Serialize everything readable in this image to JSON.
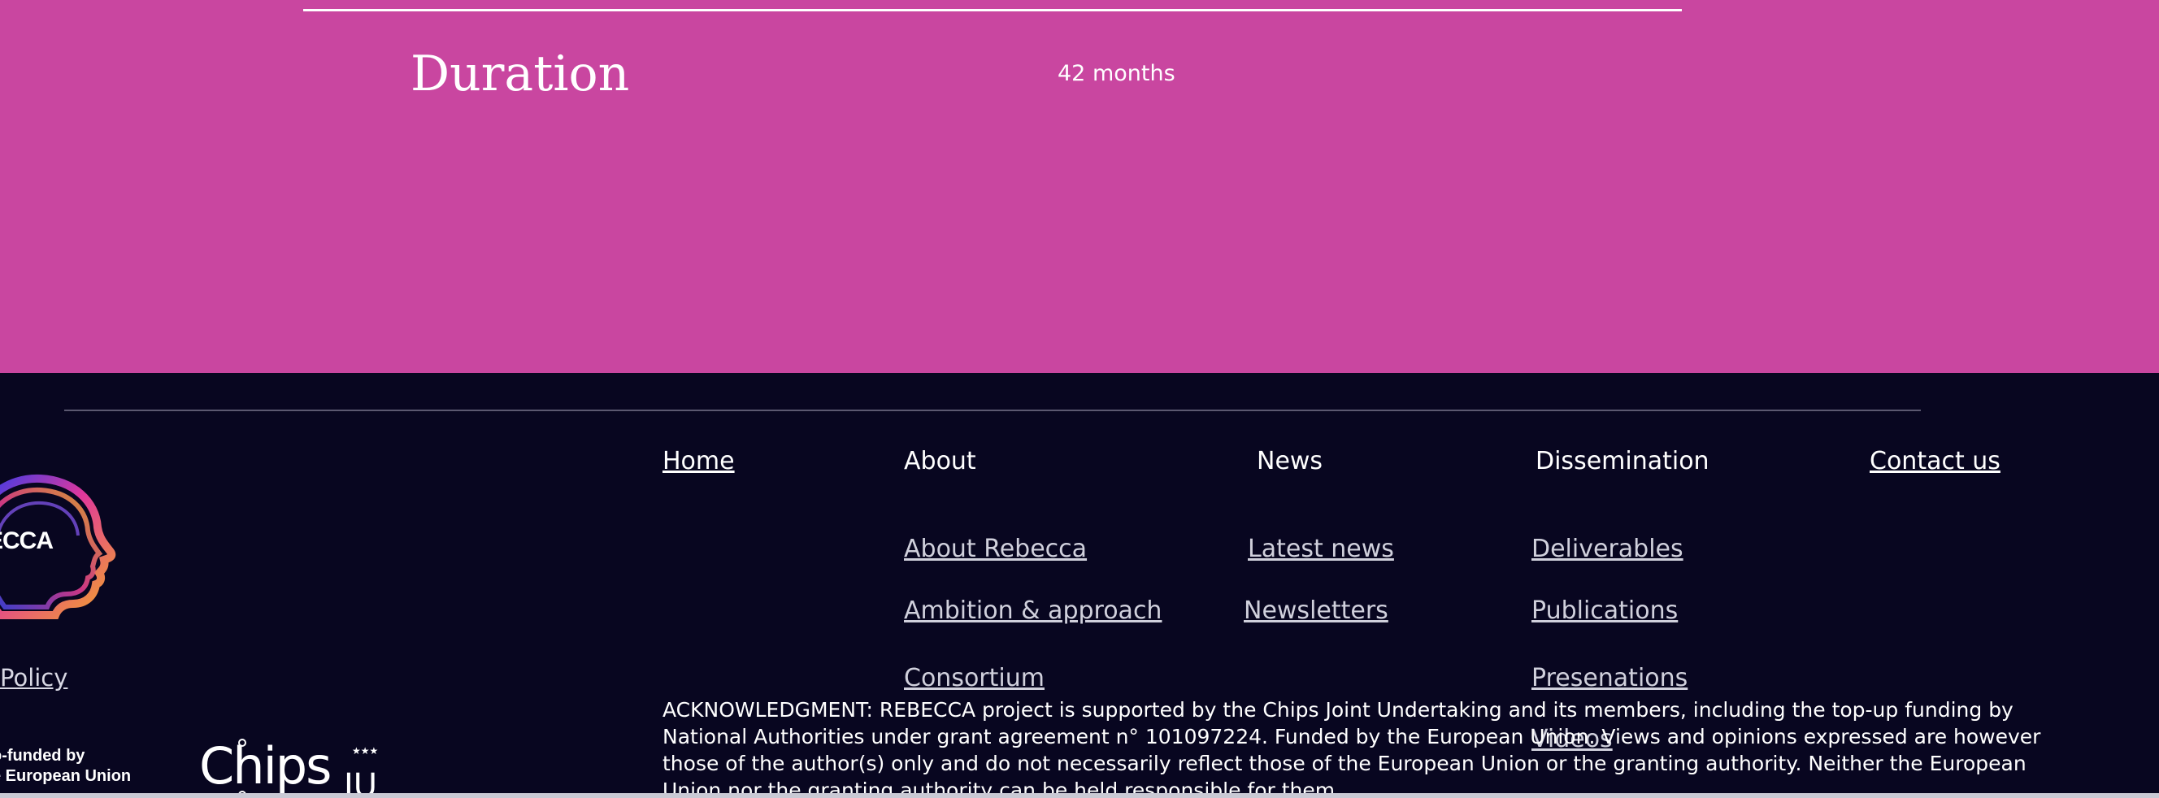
{
  "project": {
    "duration_label": "Duration",
    "duration_value": "42 months"
  },
  "footer": {
    "logo_text": "ECCA",
    "policy_link": "Policy",
    "cofunded_line1": "o-funded by",
    "cofunded_line2": "e European Union",
    "chips_logo": {
      "main": "Chips",
      "sub": "JU",
      "stars": "★★★"
    },
    "nav": {
      "home": "Home",
      "about": "About",
      "news": "News",
      "dissemination": "Dissemination",
      "contact": "Contact us"
    },
    "about_items": [
      "About Rebecca",
      "Ambition & approach",
      "Consortium"
    ],
    "news_items": [
      "Latest news",
      "Newsletters"
    ],
    "dissemination_items": [
      "Deliverables",
      "Publications",
      "Presenations",
      "Videos"
    ],
    "acknowledgment": "ACKNOWLEDGMENT: REBECCA project is supported by the Chips Joint Undertaking and its members, including the top-up funding by National Authorities under grant agreement n° 101097224. Funded by the European Union. Views and opinions expressed are however those of the author(s) only and do not necessarily reflect those of the European Union or the granting authority. Neither the European Union nor the granting authority can be held responsible for them."
  },
  "colors": {
    "hero_bg": "#c946a0",
    "footer_bg": "#080620",
    "text": "#ffffff"
  }
}
